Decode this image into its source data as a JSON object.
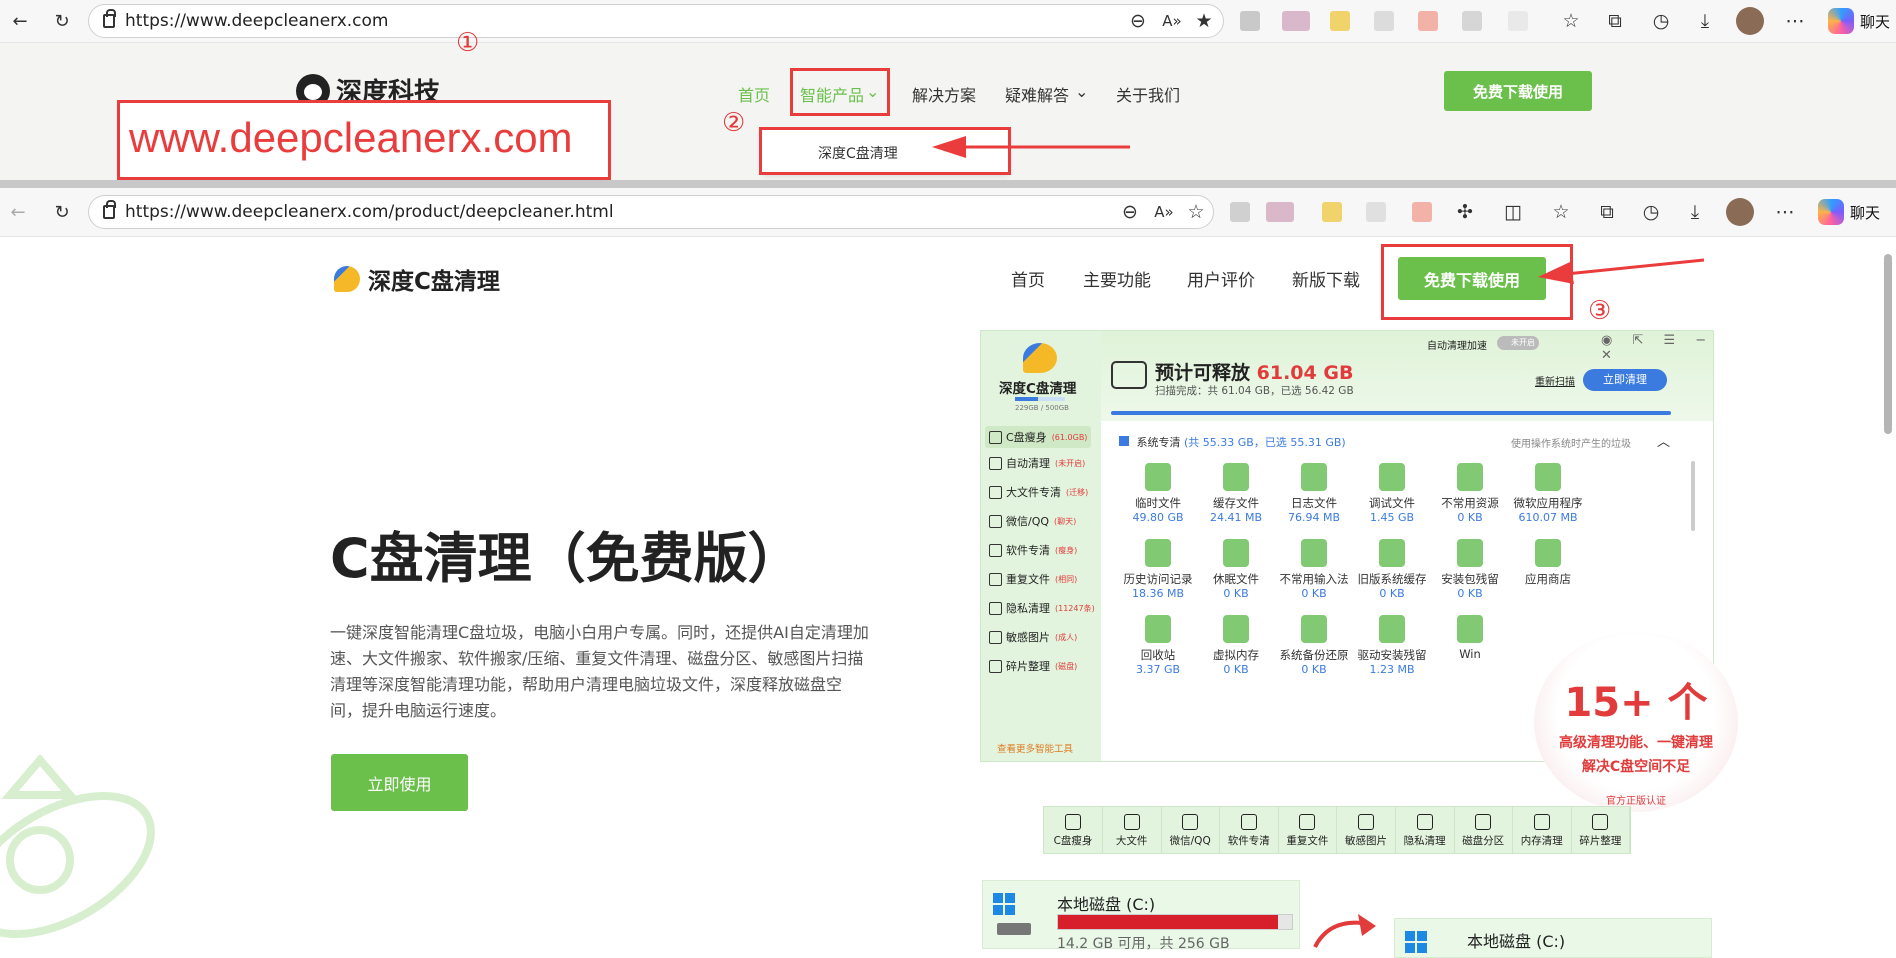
{
  "browser1": {
    "url": "https://www.deepcleanerx.com",
    "chat_label": "聊天"
  },
  "site1": {
    "logo_text": "深度科技",
    "nav": [
      "首页",
      "智能产品",
      "解决方案",
      "疑难解答",
      "关于我们"
    ],
    "download_btn": "免费下载使用",
    "dropdown_item": "深度C盘清理",
    "url_overlay": "www.deepcleanerx.com"
  },
  "annotations": {
    "step1": "①",
    "step2": "②",
    "step3": "③"
  },
  "browser2": {
    "url": "https://www.deepcleanerx.com/product/deepcleaner.html",
    "chat_label": "聊天"
  },
  "site2": {
    "logo_text": "深度C盘清理",
    "nav": [
      "首页",
      "主要功能",
      "用户评价",
      "新版下载"
    ],
    "download_btn": "免费下载使用",
    "hero_title": "C盘清理（免费版）",
    "hero_desc": "一键深度智能清理C盘垃圾，电脑小白用户专属。同时，还提供AI自定清理加速、大文件搬家、软件搬家/压缩、重复文件清理、磁盘分区、敏感图片扫描清理等深度智能清理功能，帮助用户清理电脑垃圾文件，深度释放磁盘空间，提升电脑运行速度。",
    "use_btn": "立即使用"
  },
  "app": {
    "brand": "深度C盘清理",
    "disk_usage": "229GB / 500GB",
    "auto_clean": "自动清理加速",
    "auto_state": "未开启",
    "release_label": "预计可释放",
    "release_value": "61.04 GB",
    "scan_done": "扫描完成：共 61.04 GB，已选 56.42 GB",
    "rescan": "重新扫描",
    "clean_now": "立即清理",
    "section_title": "系统专清",
    "section_stats": "(共 55.33 GB，已选 55.31 GB)",
    "section_hint": "使用操作系统时产生的垃圾",
    "side": [
      {
        "label": "C盘瘦身",
        "count": "(61.0GB)"
      },
      {
        "label": "自动清理",
        "count": "(未开启)"
      },
      {
        "label": "大文件专清",
        "count": "(迁移)"
      },
      {
        "label": "微信/QQ",
        "count": "(聊天)"
      },
      {
        "label": "软件专清",
        "count": "(瘦身)"
      },
      {
        "label": "重复文件",
        "count": "(相同)"
      },
      {
        "label": "隐私清理",
        "count": "(11247条)"
      },
      {
        "label": "敏感图片",
        "count": "(成人)"
      },
      {
        "label": "碎片整理",
        "count": "(磁盘)"
      }
    ],
    "more_tools": "查看更多智能工具",
    "items": [
      {
        "name": "临时文件",
        "size": "49.80 GB"
      },
      {
        "name": "缓存文件",
        "size": "24.41 MB"
      },
      {
        "name": "日志文件",
        "size": "76.94 MB"
      },
      {
        "name": "调试文件",
        "size": "1.45 GB"
      },
      {
        "name": "不常用资源",
        "size": "0 KB"
      },
      {
        "name": "微软应用程序",
        "size": "610.07 MB"
      },
      {
        "name": "历史访问记录",
        "size": "18.36 MB"
      },
      {
        "name": "休眠文件",
        "size": "0 KB"
      },
      {
        "name": "不常用输入法",
        "size": "0 KB"
      },
      {
        "name": "旧版系统缓存",
        "size": "0 KB"
      },
      {
        "name": "安装包残留",
        "size": "0 KB"
      },
      {
        "name": "应用商店",
        "size": ""
      },
      {
        "name": "回收站",
        "size": "3.37 GB"
      },
      {
        "name": "虚拟内存",
        "size": "0 KB"
      },
      {
        "name": "系统备份还原",
        "size": "0 KB"
      },
      {
        "name": "驱动安装残留",
        "size": "1.23 MB"
      },
      {
        "name": "Win",
        "size": ""
      }
    ]
  },
  "badge": {
    "big": "15+ 个",
    "line1": "高级清理功能、一键清理",
    "line2": "解决C盘空间不足",
    "cert": "官方正版认证"
  },
  "tools": [
    "C盘瘦身",
    "大文件",
    "微信/QQ",
    "软件专清",
    "重复文件",
    "敏感图片",
    "隐私清理",
    "磁盘分区",
    "内存清理",
    "碎片整理"
  ],
  "disk1": {
    "name": "本地磁盘 (C:)",
    "free": "14.2 GB 可用，共 256 GB",
    "used_fraction": 0.94
  },
  "disk2": {
    "name": "本地磁盘 (C:)"
  },
  "colors": {
    "green": "#6bc04b",
    "red": "#ea3c3c",
    "blue": "#3b7be0"
  }
}
